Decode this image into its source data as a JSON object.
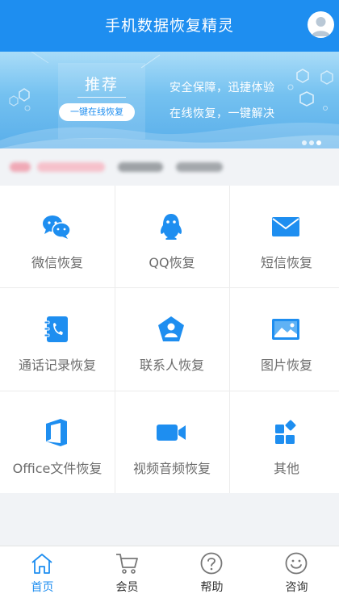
{
  "header": {
    "title": "手机数据恢复精灵",
    "avatar_icon": "user-avatar-icon"
  },
  "banner": {
    "title": "推荐",
    "button_label": "一键在线恢复",
    "line1": "安全保障，迅捷体验",
    "line2": "在线恢复，一键解决",
    "pager": {
      "count": 3,
      "active": 3
    }
  },
  "grid": {
    "items": [
      {
        "label": "微信恢复",
        "icon": "wechat-icon"
      },
      {
        "label": "QQ恢复",
        "icon": "qq-penguin-icon"
      },
      {
        "label": "短信恢复",
        "icon": "envelope-icon"
      },
      {
        "label": "通话记录恢复",
        "icon": "phone-book-icon"
      },
      {
        "label": "联系人恢复",
        "icon": "contact-pentagon-icon"
      },
      {
        "label": "图片恢复",
        "icon": "picture-icon"
      },
      {
        "label": "Office文件恢复",
        "icon": "office-icon"
      },
      {
        "label": "视频音频恢复",
        "icon": "video-camera-icon"
      },
      {
        "label": "其他",
        "icon": "apps-icon"
      }
    ]
  },
  "bottom_nav": {
    "items": [
      {
        "label": "首页",
        "icon": "home-icon",
        "active": true
      },
      {
        "label": "会员",
        "icon": "cart-icon",
        "active": false
      },
      {
        "label": "帮助",
        "icon": "question-icon",
        "active": false
      },
      {
        "label": "咨询",
        "icon": "smile-icon",
        "active": false
      }
    ]
  },
  "colors": {
    "brand": "#1e8ef0",
    "active_tab": "#1e8ef0",
    "label_gray": "#6c6c6c"
  }
}
